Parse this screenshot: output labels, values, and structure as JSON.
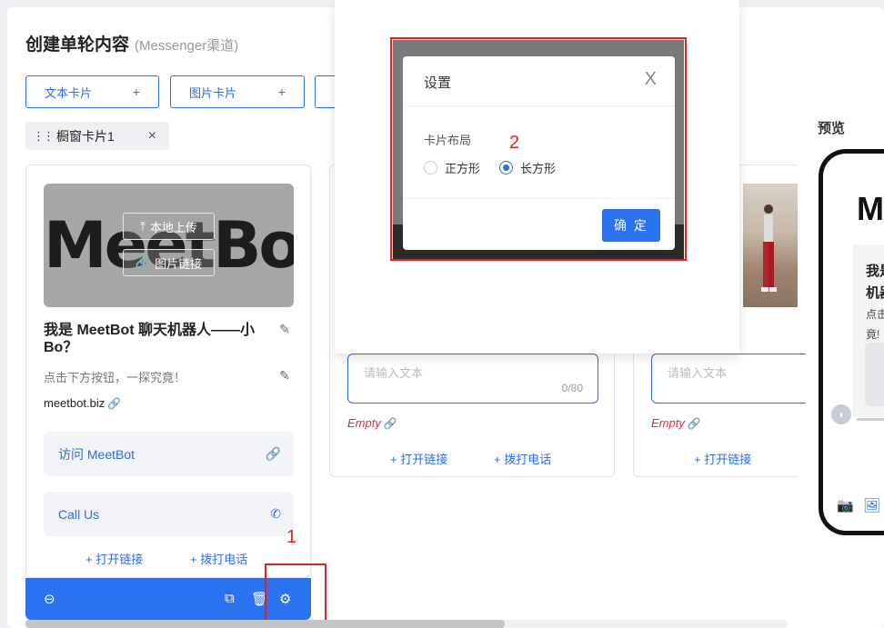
{
  "header": {
    "title": "创建单轮内容",
    "subtitle": "(Messenger渠道)"
  },
  "add_buttons": [
    {
      "label": "文本卡片",
      "plus": "+"
    },
    {
      "label": "图片卡片",
      "plus": "+"
    }
  ],
  "tab": {
    "drag": "⋮⋮",
    "label": "橱窗卡片1",
    "close": "×"
  },
  "card1": {
    "upload_local": "本地上传",
    "image_link": "图片链接",
    "logo_text": "MeetBot",
    "title": "我是 MeetBot 聊天机器人——小Bo？",
    "description": "点击下方按钮，一探究竟！",
    "link": "meetbot.biz",
    "actions": [
      {
        "label": "访问 MeetBot",
        "icon": "link-icon"
      },
      {
        "label": "Call Us",
        "icon": "phone-icon"
      }
    ],
    "add_link": "+ 打开链接",
    "add_call": "+ 拨打电话"
  },
  "card2": {
    "placeholder": "请输入文本",
    "counter": "0/80",
    "empty": "Empty",
    "add_link": "+ 打开链接",
    "add_call": "+ 拨打电话"
  },
  "card3": {
    "placeholder": "请输入文本",
    "empty": "Empty",
    "add_link": "+ 打开链接"
  },
  "dialog": {
    "title": "设置",
    "close": "X",
    "layout_label": "卡片布局",
    "options": [
      {
        "label": "正方形",
        "selected": false
      },
      {
        "label": "长方形",
        "selected": true
      }
    ],
    "confirm": "确 定"
  },
  "annotations": {
    "step1": "1",
    "step2": "2"
  },
  "preview": {
    "label": "预览",
    "logo": "M",
    "title_line1": "我是",
    "title_line2": "机器",
    "desc_line1": "点击",
    "desc_line2": "竟!"
  },
  "colors": {
    "accent": "#2b72f0",
    "annotation": "#e52020",
    "error": "#d9304a"
  }
}
